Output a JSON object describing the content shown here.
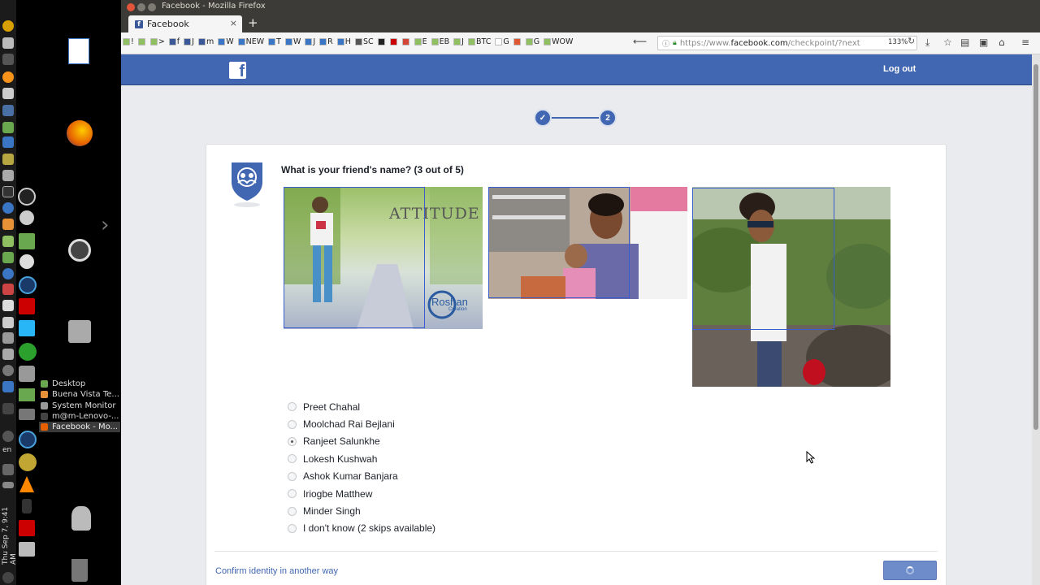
{
  "system": {
    "language": "en",
    "clock": "Thu Sep 7, 9:41 AM"
  },
  "window_list": [
    {
      "label": "Desktop",
      "color": "#6aa84f",
      "active": false
    },
    {
      "label": "Buena Vista Te...",
      "color": "#e69138",
      "active": false
    },
    {
      "label": "System Monitor",
      "color": "#999999",
      "active": false
    },
    {
      "label": "m@m-Lenovo-...",
      "color": "#444444",
      "active": false
    },
    {
      "label": "Facebook - Mo...",
      "color": "#e66000",
      "active": true
    }
  ],
  "browser": {
    "window_title": "Facebook - Mozilla Firefox",
    "tab_title": "Facebook",
    "tab_favicon_letter": "f",
    "url_prefix": "https://www.",
    "url_domain": "facebook.com",
    "url_path": "/checkpoint/?next",
    "zoom": "133%",
    "bookmarks": [
      {
        "label": "!",
        "color": "#8fbf60"
      },
      {
        "label": "",
        "color": "#8fbf60"
      },
      {
        "label": ">",
        "color": "#8fbf60"
      },
      {
        "label": "f",
        "color": "#3b5998"
      },
      {
        "label": "J",
        "color": "#3b5998"
      },
      {
        "label": "m",
        "color": "#3b5998"
      },
      {
        "label": "W",
        "color": "#3a76c4"
      },
      {
        "label": "NEW",
        "color": "#3a76c4"
      },
      {
        "label": "T",
        "color": "#3a76c4"
      },
      {
        "label": "W",
        "color": "#3a76c4"
      },
      {
        "label": "J",
        "color": "#3a76c4"
      },
      {
        "label": "R",
        "color": "#3a76c4"
      },
      {
        "label": "H",
        "color": "#3a76c4"
      },
      {
        "label": "SC",
        "color": "#555555"
      },
      {
        "label": "",
        "color": "#222222"
      },
      {
        "label": "",
        "color": "#cc0000"
      },
      {
        "label": "",
        "color": "#d44638"
      },
      {
        "label": "E",
        "color": "#8fbf60"
      },
      {
        "label": "EB",
        "color": "#8fbf60"
      },
      {
        "label": "J",
        "color": "#8fbf60"
      },
      {
        "label": "BTC",
        "color": "#8fbf60"
      },
      {
        "label": "G",
        "color": "#ffffff"
      },
      {
        "label": "",
        "color": "#de5833"
      },
      {
        "label": "G",
        "color": "#8fbf60"
      },
      {
        "label": "WOW",
        "color": "#8fbf60"
      }
    ]
  },
  "facebook": {
    "logout_label": "Log out",
    "step_two_label": "2",
    "question": "What is your friend's name? (3 out of 5)",
    "photo_texts": {
      "attitude": "ATTITUDE",
      "roshan": "Roshan",
      "creation": "Creation"
    },
    "options": [
      {
        "label": "Preet Chahal",
        "selected": false
      },
      {
        "label": "Moolchad Rai Bejlani",
        "selected": false
      },
      {
        "label": "Ranjeet Salunkhe",
        "selected": true
      },
      {
        "label": "Lokesh Kushwah",
        "selected": false
      },
      {
        "label": "Ashok Kumar Banjara",
        "selected": false
      },
      {
        "label": "Iriogbe Matthew",
        "selected": false
      },
      {
        "label": "Minder Singh",
        "selected": false
      },
      {
        "label": "I don't know (2 skips available)",
        "selected": false
      }
    ],
    "confirm_link": "Confirm identity in another way",
    "brand_color": "#4267b2"
  }
}
